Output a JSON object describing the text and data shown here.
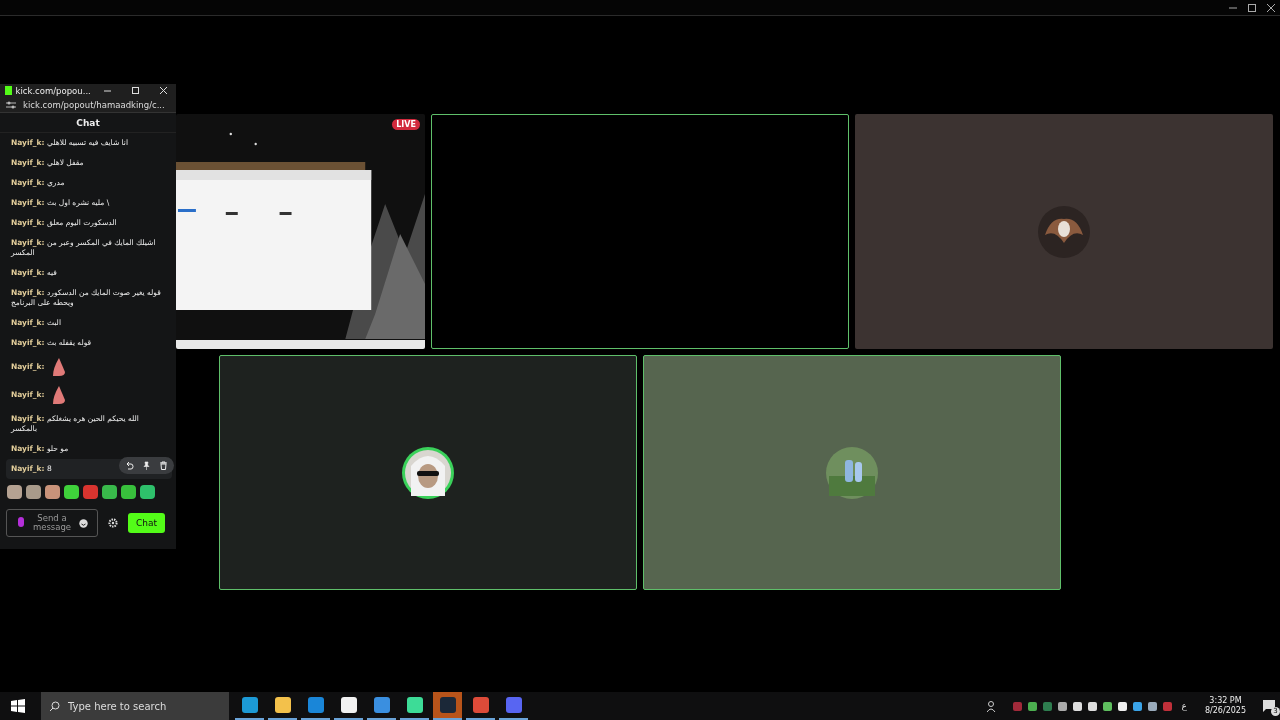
{
  "chat_window": {
    "title": "kick.com/popou...",
    "address": "kick.com/popout/hamaadking/c...",
    "header": "Chat",
    "messages": [
      {
        "kind": "text",
        "user": "Nayif_k:",
        "text": "انا شايف فيه تسبيه للاهلي",
        "highlighted": false
      },
      {
        "kind": "text",
        "user": "Nayif_k:",
        "text": "مقفل لاهلي",
        "highlighted": false
      },
      {
        "kind": "text",
        "user": "Nayif_k:",
        "text": "مدري",
        "highlighted": false
      },
      {
        "kind": "text",
        "user": "Nayif_k:",
        "text": "\\ مليه نشره اول بث",
        "highlighted": false
      },
      {
        "kind": "text",
        "user": "Nayif_k:",
        "text": "الدسكورت اليوم معلق",
        "highlighted": false
      },
      {
        "kind": "text",
        "user": "Nayif_k:",
        "text": "اشيلك المايك في المكسر وعبر من المكسر",
        "highlighted": false
      },
      {
        "kind": "text",
        "user": "Nayif_k:",
        "text": "فيه",
        "highlighted": false
      },
      {
        "kind": "text",
        "user": "Nayif_k:",
        "text": "قوله يغير صوت المايك من الدسكورد ويحطه على البرنامج",
        "highlighted": false
      },
      {
        "kind": "text",
        "user": "Nayif_k:",
        "text": "البث",
        "highlighted": false
      },
      {
        "kind": "text",
        "user": "Nayif_k:",
        "text": "قوله يقفله بث",
        "highlighted": false
      },
      {
        "kind": "emote",
        "user": "Nayif_k:",
        "highlighted": false
      },
      {
        "kind": "emote",
        "user": "Nayif_k:",
        "highlighted": false
      },
      {
        "kind": "text",
        "user": "Nayif_k:",
        "text": "الله يحيكم الحين هره يشغلكم بالمكسر",
        "highlighted": false
      },
      {
        "kind": "text",
        "user": "Nayif_k:",
        "text": "مو حلو",
        "highlighted": false
      },
      {
        "kind": "text",
        "user": "Nayif_k:",
        "text": "8",
        "highlighted": true
      }
    ],
    "input": {
      "placeholder": "Send a message"
    },
    "send_button": "Chat"
  },
  "tiles": [
    {
      "kind": "stream",
      "badge": "LIVE",
      "color": "#0b0b0b"
    },
    {
      "kind": "blank",
      "color": "#000000"
    },
    {
      "kind": "avatar",
      "color": "#3c3331"
    },
    {
      "kind": "avatar",
      "color": "#1e221f"
    },
    {
      "kind": "avatar",
      "color": "#56654f"
    }
  ],
  "taskbar": {
    "search": {
      "placeholder": "Type here to search"
    },
    "apps": [
      {
        "kind": "edge",
        "selected": false
      },
      {
        "kind": "folder",
        "selected": false
      },
      {
        "kind": "mail",
        "selected": false
      },
      {
        "kind": "store",
        "selected": false
      },
      {
        "kind": "photos",
        "selected": false
      },
      {
        "kind": "chatapp",
        "selected": false
      },
      {
        "kind": "steam",
        "selected": true
      },
      {
        "kind": "chrome",
        "selected": false
      },
      {
        "kind": "discord",
        "selected": false
      }
    ],
    "language": "ع",
    "time": "3:32 PM",
    "date": "8/26/2025",
    "notifications": "3"
  }
}
